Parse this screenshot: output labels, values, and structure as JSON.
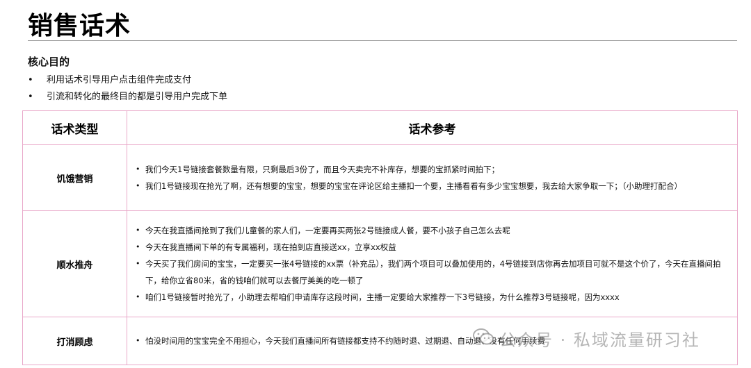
{
  "title": "销售话术",
  "goal": {
    "heading": "核心目的",
    "items": [
      "利用话术引导用户点击组件完成支付",
      "引流和转化的最终目的都是引导用户完成下单"
    ]
  },
  "table": {
    "headers": [
      "话术类型",
      "话术参考"
    ],
    "rows": [
      {
        "type": "饥饿营销",
        "refs": [
          "我们今天1号链接套餐数量有限，只剩最后3份了，而且今天卖完不补库存，想要的宝抓紧时间拍下；",
          "我们1号链接现在抢光了啊，还有想要的宝宝，想要的宝宝在评论区给主播扣一个要，主播看看有多少宝宝想要，我去给大家争取一下；（小助理打配合）"
        ]
      },
      {
        "type": "顺水推舟",
        "refs": [
          "今天在我直播间抢到了我们儿童餐的家人们，一定要再买两张2号链接成人餐，要不小孩子自己怎么去呢",
          "今天在我直播间下单的有专属福利，现在拍到店直接送xx，立享xx权益",
          "今天买了我们房间的宝宝，一定要买一张4号链接的xx票（补充品），我们两个项目可以叠加使用的，4号链接到店你再去加项目可就不是这个价了，今天在直播间拍下，给你立省80米，省的钱咱们就可以去餐厅美美的吃一顿了",
          "咱们1号链接暂时抢光了，小助理去帮咱们申请库存这段时间，主播一定要给大家推荐一下3号链接，为什么推荐3号链接呢，因为xxxx"
        ]
      },
      {
        "type": "打消顾虑",
        "refs": [
          "怕没时间用的宝宝完全不用担心，今天我们直播间所有链接都支持不约随时退、过期退、自动退、没有任何手续费"
        ]
      }
    ]
  },
  "watermark": {
    "icon": "wechat-official-account-icon",
    "text": "公众号 · 私域流量研习社"
  }
}
